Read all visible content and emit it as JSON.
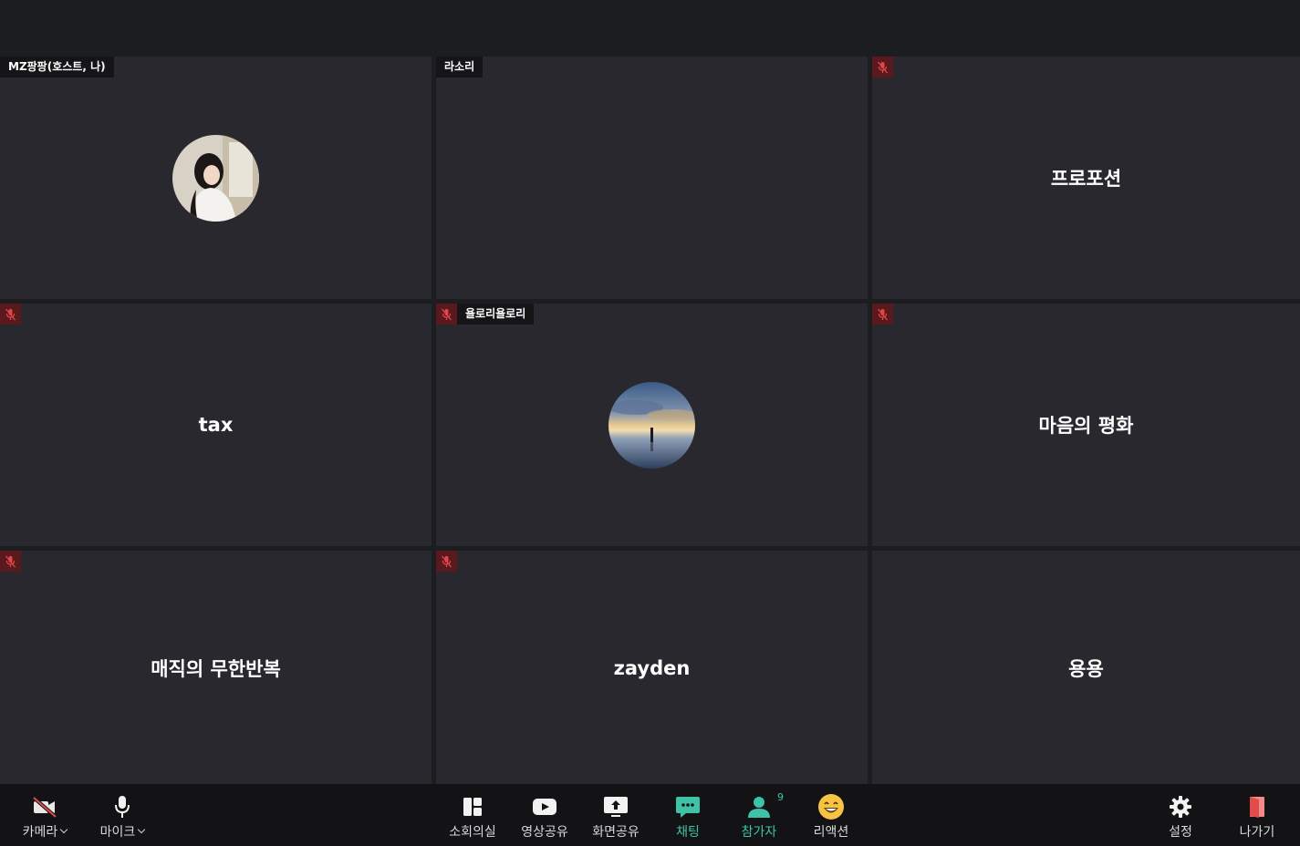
{
  "tiles": [
    {
      "name_label": "MZ팡팡(호스트, 나)",
      "muted": false,
      "display_name": "",
      "avatar": "woman-photo"
    },
    {
      "name_label": "라소리",
      "muted": false,
      "display_name": "",
      "avatar": ""
    },
    {
      "name_label": "",
      "muted": true,
      "display_name": "프로포션",
      "avatar": ""
    },
    {
      "name_label": "",
      "muted": true,
      "display_name": "tax",
      "avatar": ""
    },
    {
      "name_label": "욜로리욜로리",
      "muted": true,
      "display_name": "",
      "avatar": "sunset-photo"
    },
    {
      "name_label": "",
      "muted": true,
      "display_name": "마음의 평화",
      "avatar": ""
    },
    {
      "name_label": "",
      "muted": true,
      "display_name": "매직의 무한반복",
      "avatar": ""
    },
    {
      "name_label": "",
      "muted": true,
      "display_name": "zayden",
      "avatar": ""
    },
    {
      "name_label": "",
      "muted": false,
      "display_name": "용용",
      "avatar": ""
    }
  ],
  "toolbar": {
    "camera": {
      "label": "카메라",
      "icon": "camera-off-icon"
    },
    "mic": {
      "label": "마이크",
      "icon": "microphone-icon"
    },
    "breakout": {
      "label": "소회의실",
      "icon": "breakout-rooms-icon"
    },
    "video_share": {
      "label": "영상공유",
      "icon": "youtube-icon"
    },
    "screen_share": {
      "label": "화면공유",
      "icon": "screen-share-icon"
    },
    "chat": {
      "label": "채팅",
      "icon": "chat-icon"
    },
    "participants": {
      "label": "참가자",
      "count": "9",
      "icon": "participants-icon"
    },
    "reaction": {
      "label": "리액션",
      "icon": "smile-icon"
    },
    "settings": {
      "label": "설정",
      "icon": "gear-icon"
    },
    "leave": {
      "label": "나가기",
      "icon": "exit-door-icon"
    }
  },
  "colors": {
    "tile_bg": "#28282e",
    "app_bg": "#1c1d21",
    "toolbar_bg": "#131315",
    "accent_green": "#3ec3a7",
    "mute_red": "#5a1a1d",
    "leave_red": "#e24b4b"
  }
}
